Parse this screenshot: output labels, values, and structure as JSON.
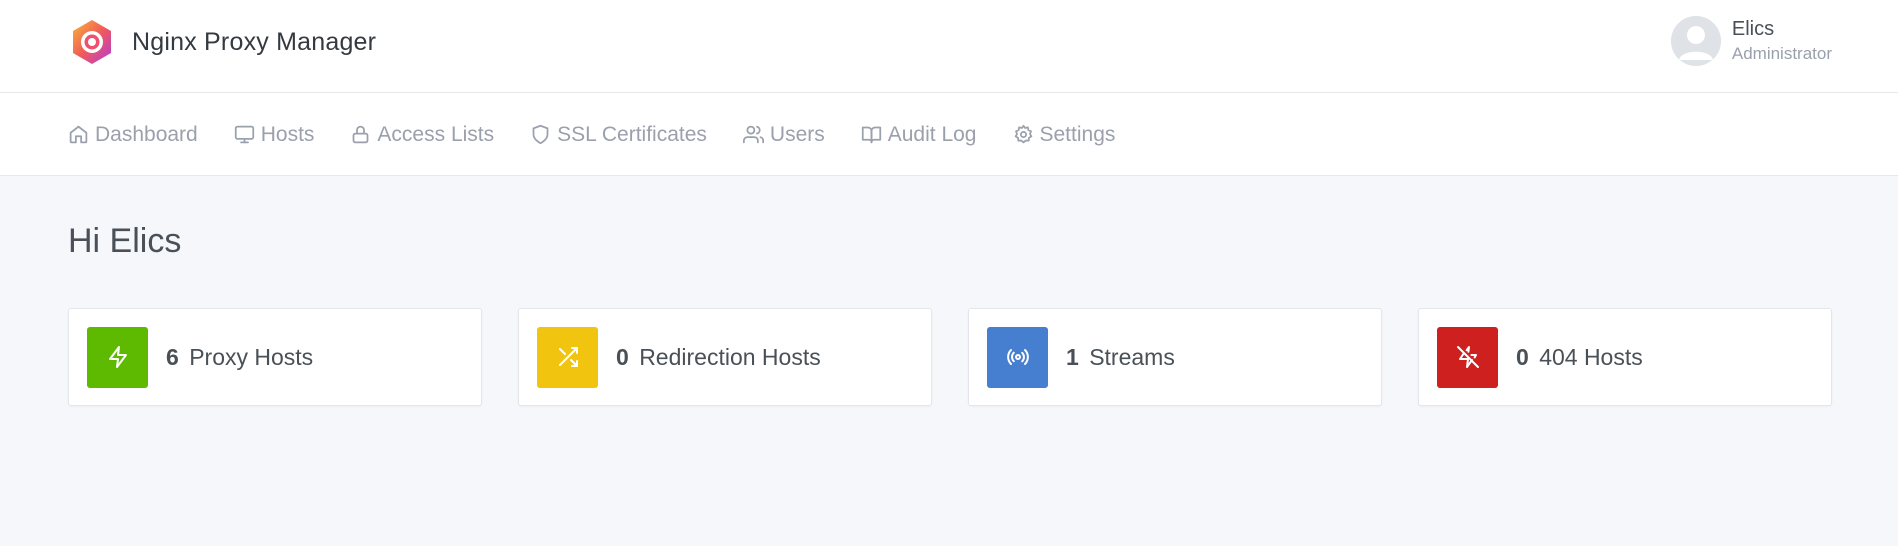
{
  "app": {
    "title": "Nginx Proxy Manager"
  },
  "user": {
    "name": "Elics",
    "role": "Administrator"
  },
  "nav": {
    "items": [
      {
        "label": "Dashboard",
        "icon": "home-icon"
      },
      {
        "label": "Hosts",
        "icon": "monitor-icon"
      },
      {
        "label": "Access Lists",
        "icon": "lock-icon"
      },
      {
        "label": "SSL Certificates",
        "icon": "shield-icon"
      },
      {
        "label": "Users",
        "icon": "users-icon"
      },
      {
        "label": "Audit Log",
        "icon": "book-open-icon"
      },
      {
        "label": "Settings",
        "icon": "gear-icon"
      }
    ]
  },
  "greeting": "Hi Elics",
  "cards": [
    {
      "count": "6",
      "label": "Proxy Hosts",
      "icon": "zap-icon",
      "color": "#5eba00"
    },
    {
      "count": "0",
      "label": "Redirection Hosts",
      "icon": "shuffle-icon",
      "color": "#f1c40f"
    },
    {
      "count": "1",
      "label": "Streams",
      "icon": "radio-icon",
      "color": "#467fcf"
    },
    {
      "count": "0",
      "label": "404 Hosts",
      "icon": "zap-off-icon",
      "color": "#cd201f"
    }
  ],
  "colors": {
    "page_background": "#f5f7fb",
    "muted_text": "#9aa0ac"
  }
}
